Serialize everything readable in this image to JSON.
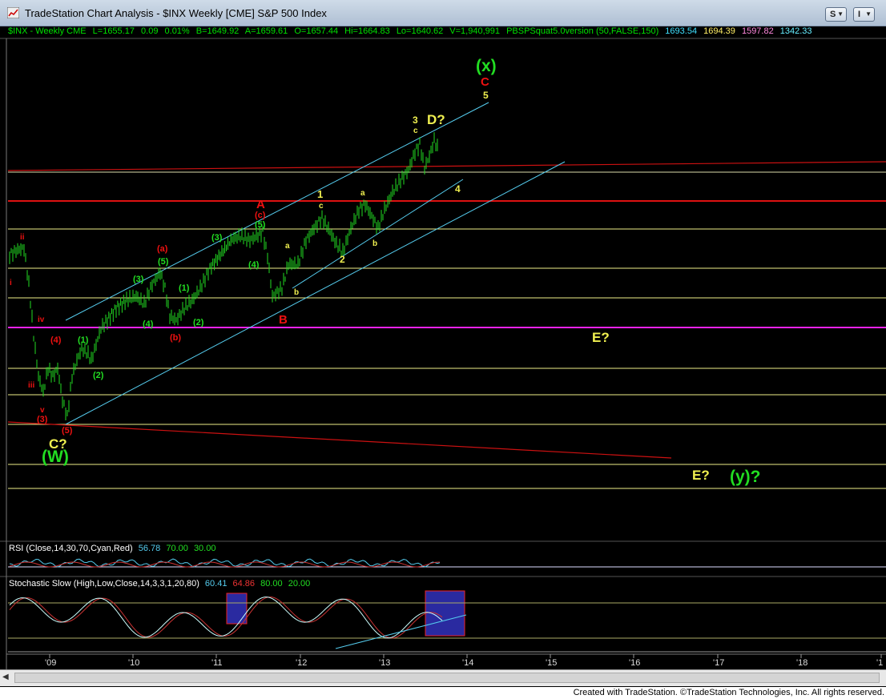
{
  "window": {
    "title": "TradeStation Chart Analysis - $INX Weekly [CME] S&P 500 Index",
    "btn_s": "S",
    "btn_i": "I"
  },
  "header": {
    "symbol": "$INX - Weekly  CME",
    "last": "L=1655.17",
    "chg": "0.09",
    "pct": "0.01%",
    "bid": "B=1649.92",
    "ask": "A=1659.61",
    "open": "O=1657.44",
    "high": "Hi=1664.83",
    "low": "Lo=1640.62",
    "vol": "V=1,940,991",
    "indicator": "PBSPSquat5.0version (50,FALSE,150)",
    "v1": "1693.54",
    "v2": "1694.39",
    "v3": "1597.82",
    "v4": "1342.33"
  },
  "rsi": {
    "label": "RSI (Close,14,30,70,Cyan,Red)",
    "value": "56.78",
    "upper": "70.00",
    "lower": "30.00"
  },
  "stoch": {
    "label": "Stochastic Slow (High,Low,Close,14,3,3,1,20,80)",
    "v1": "60.41",
    "v2": "64.86",
    "upper": "80.00",
    "lower": "20.00"
  },
  "x_axis": [
    "'09",
    "'10",
    "'11",
    "'12",
    "'13",
    "'14",
    "'15",
    "'16",
    "'17",
    "'18",
    "'1"
  ],
  "annotations": {
    "w": "(W)",
    "c_q": "C?",
    "x": "(x)",
    "c_red": "C",
    "five_y": "5",
    "three": "3",
    "c_small": "c",
    "d_q": "D?",
    "four_y": "4",
    "one": "1",
    "c1": "c",
    "a1": "a",
    "b1": "b",
    "two": "2",
    "a_red": "A",
    "c_paren": "(c)",
    "five_g": "(5)",
    "four_g": "(4)",
    "three_g": "(3)",
    "a2": "a",
    "b2": "b",
    "b_red": "B",
    "a_paren": "(a)",
    "five_g2": "(5)",
    "three_g2": "(3)",
    "one_g": "(1)",
    "four_g2": "(4)",
    "two_g": "(2)",
    "b_paren": "(b)",
    "ii": "ii",
    "i": "i",
    "iv": "iv",
    "four_red": "(4)",
    "one_g2": "(1)",
    "two_g2": "(2)",
    "iii": "iii",
    "v": "v",
    "three_red": "(3)",
    "five_red": "(5)",
    "e_q": "E?",
    "e_q2": "E?",
    "y_q": "(y)?"
  },
  "colors": {
    "bg": "#000000",
    "green": "#22dd22",
    "yellow": "#f0f050",
    "red": "#ee1111",
    "cyan": "#55ccee",
    "magenta": "#ee22ee",
    "hline": "#ffffaa"
  },
  "footer": "Created with TradeStation. ©TradeStation Technologies, Inc. All rights reserved."
}
